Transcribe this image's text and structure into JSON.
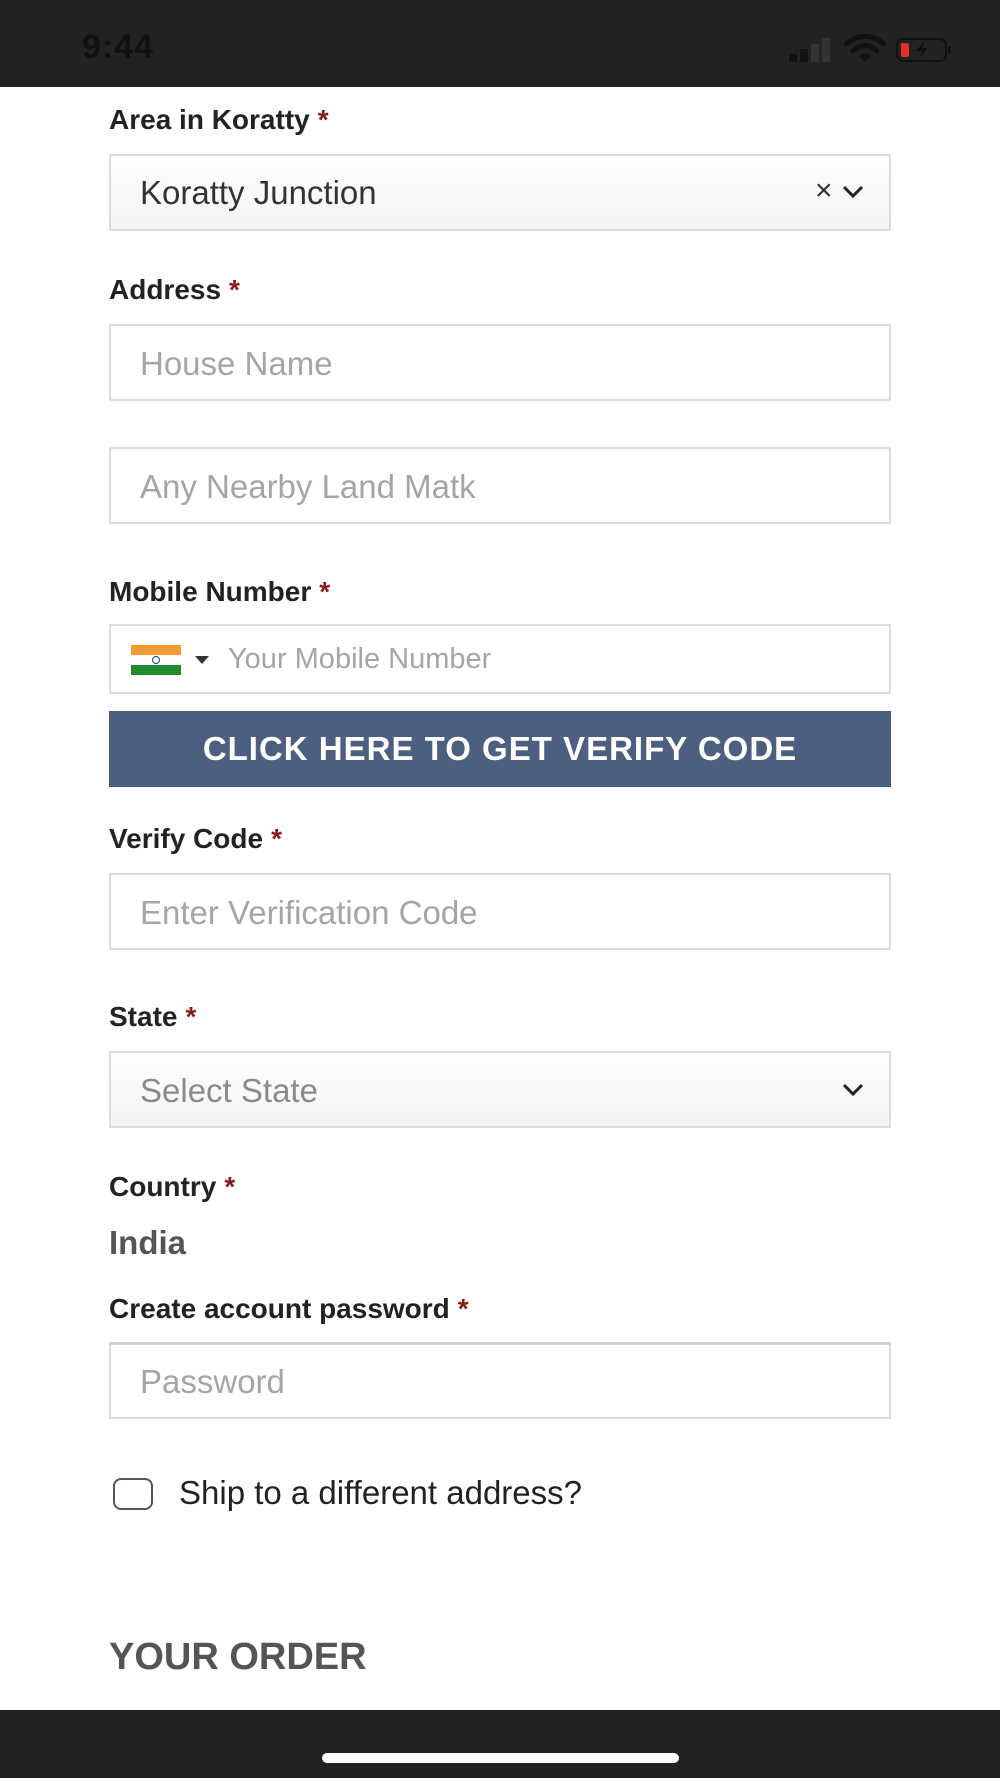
{
  "status_bar": {
    "time": "9:44"
  },
  "form": {
    "area": {
      "label": "Area in Koratty",
      "required_mark": "*",
      "value": "Koratty Junction",
      "clear_glyph": "×"
    },
    "address": {
      "label": "Address",
      "required_mark": "*",
      "house_placeholder": "House Name",
      "landmark_placeholder": "Any Nearby Land Matk"
    },
    "mobile": {
      "label": "Mobile Number",
      "required_mark": "*",
      "placeholder": "Your Mobile Number",
      "country_flag": "india-flag"
    },
    "verify_button": "CLICK HERE TO GET VERIFY CODE",
    "verify_code": {
      "label": "Verify Code",
      "required_mark": "*",
      "placeholder": "Enter Verification Code"
    },
    "state": {
      "label": "State",
      "required_mark": "*",
      "placeholder": "Select State"
    },
    "country": {
      "label": "Country",
      "required_mark": "*",
      "value": "India"
    },
    "password": {
      "label": "Create account password",
      "required_mark": "*",
      "placeholder": "Password"
    },
    "ship_different": {
      "label": "Ship to a different address?",
      "checked": false
    }
  },
  "order": {
    "heading": "YOUR ORDER"
  },
  "colors": {
    "verify_button": "#4c5f80",
    "required": "#8b1a1a",
    "status_bar": "#222222"
  }
}
